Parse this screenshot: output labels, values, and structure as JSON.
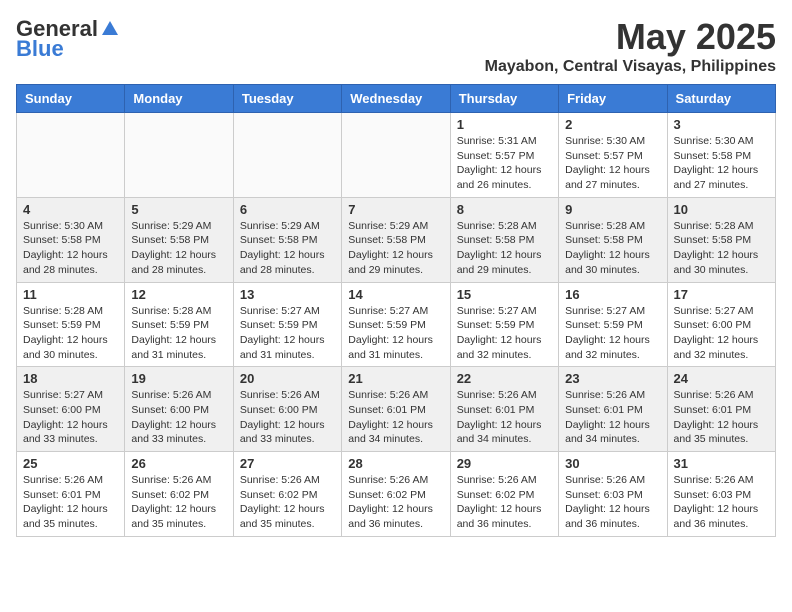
{
  "logo": {
    "general": "General",
    "blue": "Blue"
  },
  "title": "May 2025",
  "location": "Mayabon, Central Visayas, Philippines",
  "days_of_week": [
    "Sunday",
    "Monday",
    "Tuesday",
    "Wednesday",
    "Thursday",
    "Friday",
    "Saturday"
  ],
  "weeks": [
    [
      {
        "day": "",
        "info": ""
      },
      {
        "day": "",
        "info": ""
      },
      {
        "day": "",
        "info": ""
      },
      {
        "day": "",
        "info": ""
      },
      {
        "day": "1",
        "info": "Sunrise: 5:31 AM\nSunset: 5:57 PM\nDaylight: 12 hours\nand 26 minutes."
      },
      {
        "day": "2",
        "info": "Sunrise: 5:30 AM\nSunset: 5:57 PM\nDaylight: 12 hours\nand 27 minutes."
      },
      {
        "day": "3",
        "info": "Sunrise: 5:30 AM\nSunset: 5:58 PM\nDaylight: 12 hours\nand 27 minutes."
      }
    ],
    [
      {
        "day": "4",
        "info": "Sunrise: 5:30 AM\nSunset: 5:58 PM\nDaylight: 12 hours\nand 28 minutes."
      },
      {
        "day": "5",
        "info": "Sunrise: 5:29 AM\nSunset: 5:58 PM\nDaylight: 12 hours\nand 28 minutes."
      },
      {
        "day": "6",
        "info": "Sunrise: 5:29 AM\nSunset: 5:58 PM\nDaylight: 12 hours\nand 28 minutes."
      },
      {
        "day": "7",
        "info": "Sunrise: 5:29 AM\nSunset: 5:58 PM\nDaylight: 12 hours\nand 29 minutes."
      },
      {
        "day": "8",
        "info": "Sunrise: 5:28 AM\nSunset: 5:58 PM\nDaylight: 12 hours\nand 29 minutes."
      },
      {
        "day": "9",
        "info": "Sunrise: 5:28 AM\nSunset: 5:58 PM\nDaylight: 12 hours\nand 30 minutes."
      },
      {
        "day": "10",
        "info": "Sunrise: 5:28 AM\nSunset: 5:58 PM\nDaylight: 12 hours\nand 30 minutes."
      }
    ],
    [
      {
        "day": "11",
        "info": "Sunrise: 5:28 AM\nSunset: 5:59 PM\nDaylight: 12 hours\nand 30 minutes."
      },
      {
        "day": "12",
        "info": "Sunrise: 5:28 AM\nSunset: 5:59 PM\nDaylight: 12 hours\nand 31 minutes."
      },
      {
        "day": "13",
        "info": "Sunrise: 5:27 AM\nSunset: 5:59 PM\nDaylight: 12 hours\nand 31 minutes."
      },
      {
        "day": "14",
        "info": "Sunrise: 5:27 AM\nSunset: 5:59 PM\nDaylight: 12 hours\nand 31 minutes."
      },
      {
        "day": "15",
        "info": "Sunrise: 5:27 AM\nSunset: 5:59 PM\nDaylight: 12 hours\nand 32 minutes."
      },
      {
        "day": "16",
        "info": "Sunrise: 5:27 AM\nSunset: 5:59 PM\nDaylight: 12 hours\nand 32 minutes."
      },
      {
        "day": "17",
        "info": "Sunrise: 5:27 AM\nSunset: 6:00 PM\nDaylight: 12 hours\nand 32 minutes."
      }
    ],
    [
      {
        "day": "18",
        "info": "Sunrise: 5:27 AM\nSunset: 6:00 PM\nDaylight: 12 hours\nand 33 minutes."
      },
      {
        "day": "19",
        "info": "Sunrise: 5:26 AM\nSunset: 6:00 PM\nDaylight: 12 hours\nand 33 minutes."
      },
      {
        "day": "20",
        "info": "Sunrise: 5:26 AM\nSunset: 6:00 PM\nDaylight: 12 hours\nand 33 minutes."
      },
      {
        "day": "21",
        "info": "Sunrise: 5:26 AM\nSunset: 6:01 PM\nDaylight: 12 hours\nand 34 minutes."
      },
      {
        "day": "22",
        "info": "Sunrise: 5:26 AM\nSunset: 6:01 PM\nDaylight: 12 hours\nand 34 minutes."
      },
      {
        "day": "23",
        "info": "Sunrise: 5:26 AM\nSunset: 6:01 PM\nDaylight: 12 hours\nand 34 minutes."
      },
      {
        "day": "24",
        "info": "Sunrise: 5:26 AM\nSunset: 6:01 PM\nDaylight: 12 hours\nand 35 minutes."
      }
    ],
    [
      {
        "day": "25",
        "info": "Sunrise: 5:26 AM\nSunset: 6:01 PM\nDaylight: 12 hours\nand 35 minutes."
      },
      {
        "day": "26",
        "info": "Sunrise: 5:26 AM\nSunset: 6:02 PM\nDaylight: 12 hours\nand 35 minutes."
      },
      {
        "day": "27",
        "info": "Sunrise: 5:26 AM\nSunset: 6:02 PM\nDaylight: 12 hours\nand 35 minutes."
      },
      {
        "day": "28",
        "info": "Sunrise: 5:26 AM\nSunset: 6:02 PM\nDaylight: 12 hours\nand 36 minutes."
      },
      {
        "day": "29",
        "info": "Sunrise: 5:26 AM\nSunset: 6:02 PM\nDaylight: 12 hours\nand 36 minutes."
      },
      {
        "day": "30",
        "info": "Sunrise: 5:26 AM\nSunset: 6:03 PM\nDaylight: 12 hours\nand 36 minutes."
      },
      {
        "day": "31",
        "info": "Sunrise: 5:26 AM\nSunset: 6:03 PM\nDaylight: 12 hours\nand 36 minutes."
      }
    ]
  ]
}
